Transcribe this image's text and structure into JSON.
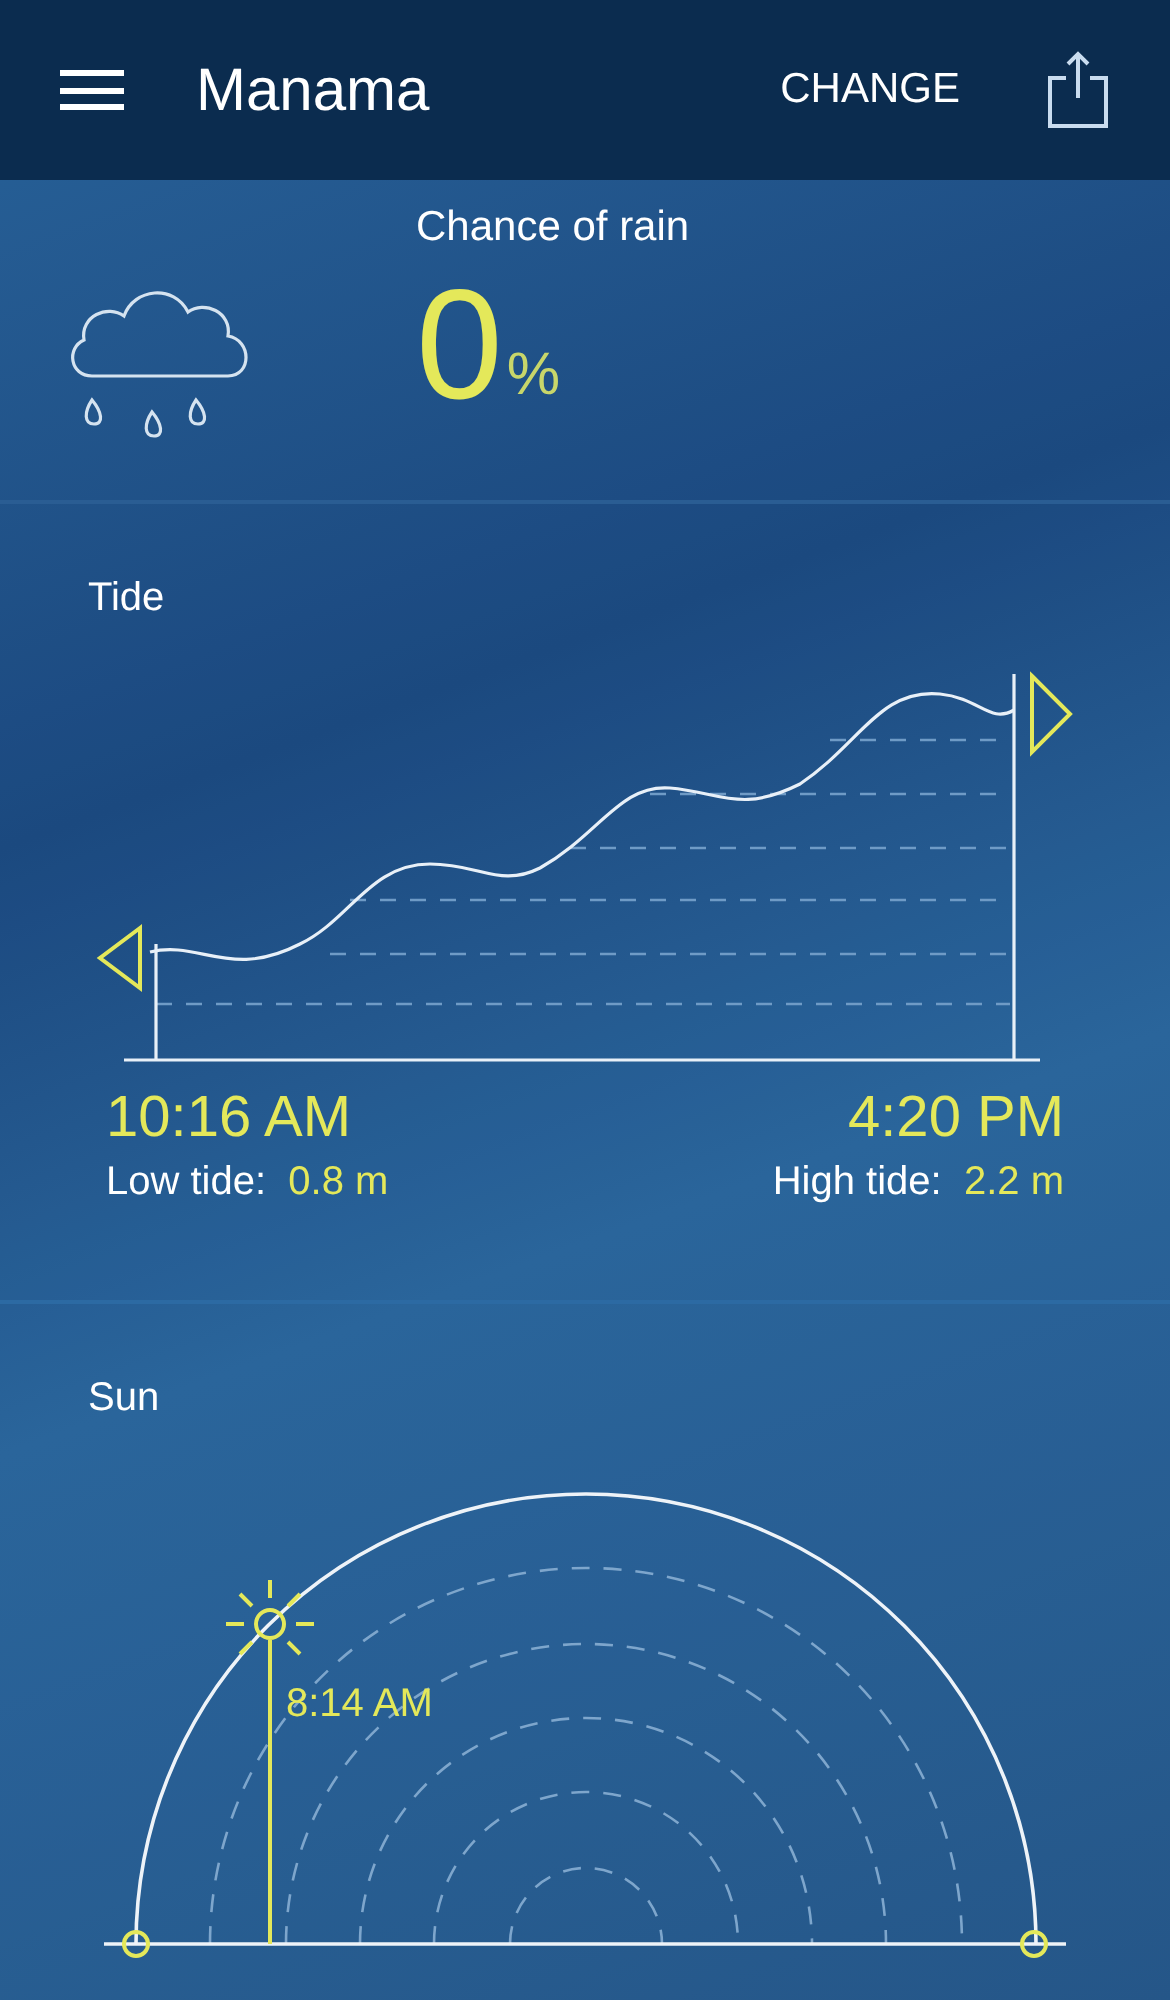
{
  "app_bar": {
    "title": "Manama",
    "action": "CHANGE"
  },
  "rain": {
    "label": "Chance of rain",
    "value": "0",
    "unit": "%"
  },
  "tide": {
    "title": "Tide",
    "low": {
      "time": "10:16 AM",
      "label": "Low tide:",
      "height": "0.8 m"
    },
    "high": {
      "time": "4:20 PM",
      "label": "High tide:",
      "height": "2.2 m"
    }
  },
  "sun": {
    "title": "Sun",
    "time": "8:14 AM"
  }
}
